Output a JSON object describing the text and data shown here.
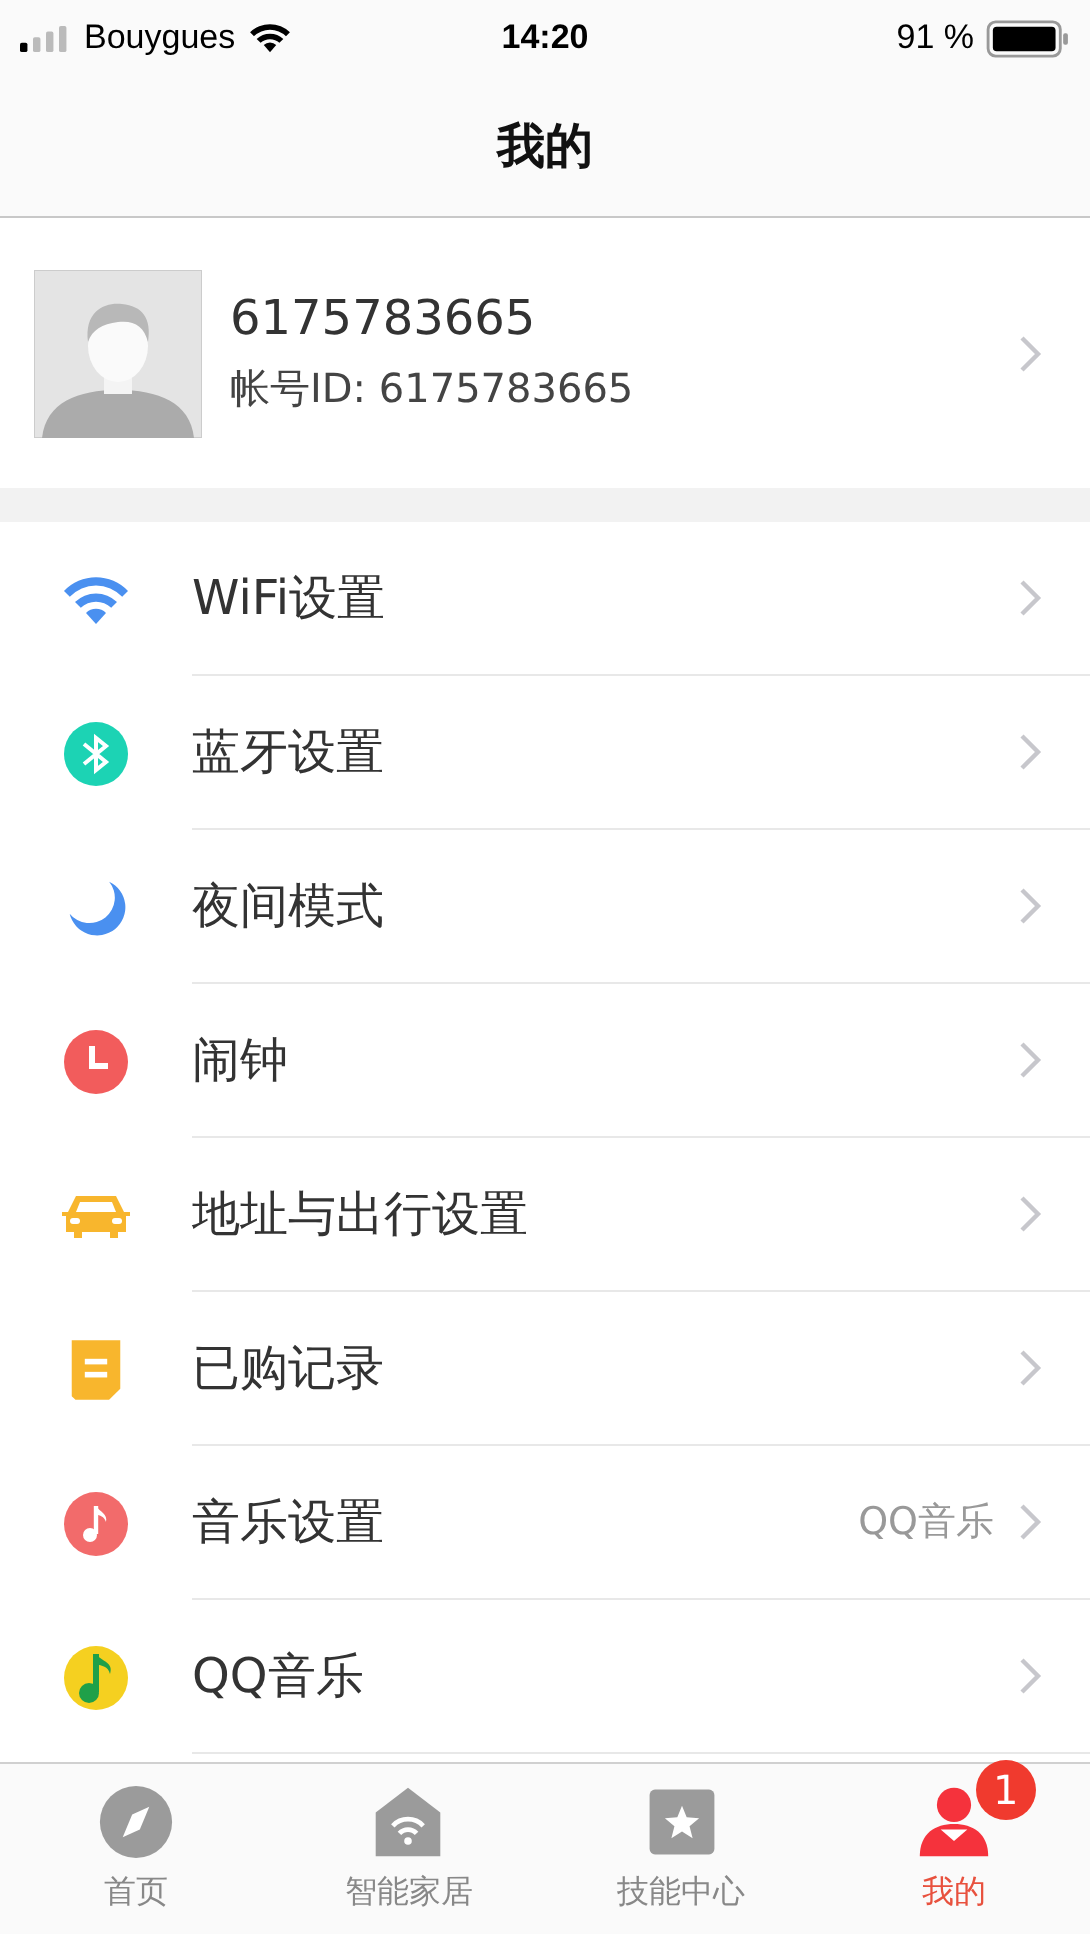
{
  "status_bar": {
    "carrier": "Bouygues",
    "time": "14:20",
    "battery": "91 %"
  },
  "window": {
    "title": "我的"
  },
  "profile": {
    "name": "6175783665",
    "account": "帐号ID: 6175783665"
  },
  "menu": [
    {
      "kind": "wifi",
      "label": "WiFi设置"
    },
    {
      "kind": "bluetooth",
      "label": "蓝牙设置"
    },
    {
      "kind": "moon",
      "label": "夜间模式"
    },
    {
      "kind": "clock",
      "label": "闹钟"
    },
    {
      "kind": "car",
      "label": "地址与出行设置"
    },
    {
      "kind": "receipt",
      "label": "已购记录"
    },
    {
      "kind": "music",
      "label": "音乐设置",
      "value": "QQ音乐"
    },
    {
      "kind": "qqmusic",
      "label": "QQ音乐"
    }
  ],
  "tabs": [
    {
      "kind": "compass",
      "label": "首页",
      "selected": false
    },
    {
      "kind": "house",
      "label": "智能家居",
      "selected": false
    },
    {
      "kind": "star",
      "label": "技能中心",
      "selected": false
    },
    {
      "kind": "person",
      "label": "我的",
      "selected": true,
      "badge": "1"
    }
  ]
}
